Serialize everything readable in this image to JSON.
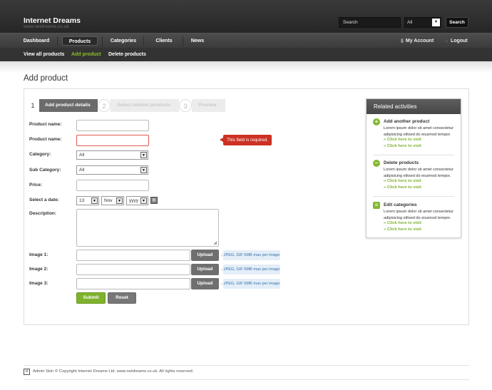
{
  "brand": {
    "title": "Internet Dreams",
    "subtitle": "www.netdreams.co.uk"
  },
  "header_search": {
    "placeholder": "Search",
    "scope": "All",
    "button": "Search"
  },
  "nav": {
    "items": [
      "Dashboard",
      "Products",
      "Categories",
      "Clients",
      "News"
    ],
    "active": "Products",
    "account": "My Account",
    "logout": "Logout"
  },
  "subnav": {
    "items": [
      "View all products",
      "Add product",
      "Delete products"
    ],
    "active": "Add product"
  },
  "page": {
    "title": "Add product"
  },
  "wizard": {
    "steps": [
      {
        "num": "1",
        "label": "Add product details",
        "state": "active"
      },
      {
        "num": "2",
        "label": "Select related products",
        "state": "inactive"
      },
      {
        "num": "3",
        "label": "Preview",
        "state": "inactive"
      }
    ]
  },
  "form": {
    "product_name_label": "Product name:",
    "product_name2_label": "Product name:",
    "error_message": "This field is required.",
    "category_label": "Category:",
    "category_value": "All",
    "subcategory_label": "Sub Category:",
    "subcategory_value": "All",
    "price_label": "Price:",
    "date_label": "Select a date:",
    "date_day": "13",
    "date_month": "Nov",
    "date_year": "yyyy",
    "description_label": "Description:",
    "images": [
      {
        "label": "Image 1:",
        "button": "Upload",
        "hint": "JPEG, GIF 5MB max per image"
      },
      {
        "label": "Image 2:",
        "button": "Upload",
        "hint": "JPEG, GIF 5MB max per image"
      },
      {
        "label": "Image 3:",
        "button": "Upload",
        "hint": "JPEG, GIF 5MB max per image"
      }
    ],
    "submit": "Submit",
    "reset": "Reset"
  },
  "related": {
    "title": "Related activities",
    "items": [
      {
        "icon": "plus-icon",
        "title": "Add another product",
        "desc": "Lorem ipsum dolor sit amet consectetur adipisicing elitsed do eiusmod tempor.",
        "links": [
          "Click here to visit",
          "Click here to visit"
        ]
      },
      {
        "icon": "minus-icon",
        "title": "Delete products",
        "desc": "Lorem ipsum dolor sit amet consectetur adipisicing elitsed do eiusmod tempor.",
        "links": [
          "Click here to visit",
          "Click here to visit"
        ]
      },
      {
        "icon": "edit-icon",
        "title": "Edit categories",
        "desc": "Lorem ipsum dolor sit amet consectetur adipisicing elitsed do eiusmod tempor.",
        "links": [
          "Click here to visit",
          "Click here to visit"
        ]
      }
    ]
  },
  "footer": {
    "text": "Admin Skin © Copyright Internet Dreams Ltd. www.netdreams.co.uk. All rights reserved."
  },
  "colors": {
    "accent_green": "#7fb22d",
    "error_red": "#cc3123",
    "header_dark": "#2e2e2e"
  }
}
